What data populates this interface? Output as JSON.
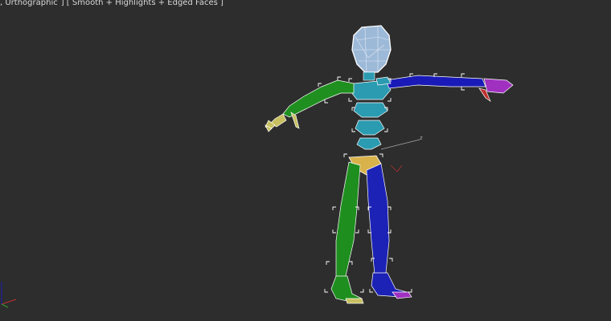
{
  "viewport": {
    "label_parts": [
      ", Urthographic",
      "] [ Smooth + Highlights + Edged Faces ]"
    ],
    "axis_tag": "z"
  },
  "colors": {
    "background": "#2d2d2d",
    "head": "#9db9d8",
    "spine": "#2a9bb0",
    "left_arm": "#1f8f1f",
    "right_arm": "#1a1ab8",
    "left_leg": "#1e8e1e",
    "right_leg": "#1c22b5",
    "pelvis": "#d8b24a",
    "left_hand": "#c8c060",
    "right_hand": "#a030c0",
    "wire": "#ffffff"
  }
}
